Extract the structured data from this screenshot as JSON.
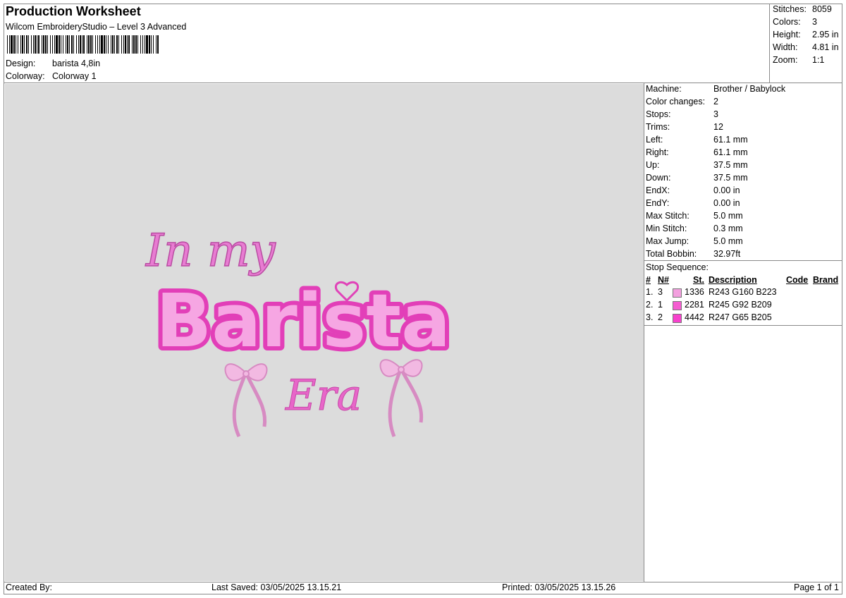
{
  "header": {
    "title": "Production Worksheet",
    "subtitle": "Wilcom EmbroideryStudio – Level 3 Advanced",
    "design_label": "Design:",
    "design_value": "barista 4,8in",
    "colorway_label": "Colorway:",
    "colorway_value": "Colorway 1"
  },
  "summary": [
    {
      "label": "Stitches:",
      "value": "8059"
    },
    {
      "label": "Colors:",
      "value": "3"
    },
    {
      "label": "Height:",
      "value": "2.95 in"
    },
    {
      "label": "Width:",
      "value": "4.81 in"
    },
    {
      "label": "Zoom:",
      "value": "1:1"
    }
  ],
  "design_text": {
    "line1": "In my",
    "line2": "Barista",
    "line3": "Era"
  },
  "machine_info": [
    {
      "label": "Machine:",
      "value": "Brother / Babylock"
    },
    {
      "label": "Color changes:",
      "value": "2"
    },
    {
      "label": "Stops:",
      "value": "3"
    },
    {
      "label": "Trims:",
      "value": "12"
    },
    {
      "label": "Left:",
      "value": "61.1 mm"
    },
    {
      "label": "Right:",
      "value": "61.1 mm"
    },
    {
      "label": "Up:",
      "value": "37.5 mm"
    },
    {
      "label": "Down:",
      "value": "37.5 mm"
    },
    {
      "label": "EndX:",
      "value": "0.00 in"
    },
    {
      "label": "EndY:",
      "value": "0.00 in"
    },
    {
      "label": "Max Stitch:",
      "value": "5.0 mm"
    },
    {
      "label": "Min Stitch:",
      "value": "0.3 mm"
    },
    {
      "label": "Max Jump:",
      "value": "5.0 mm"
    },
    {
      "label": "Total Bobbin:",
      "value": "32.97ft"
    }
  ],
  "stop_sequence": {
    "title": "Stop Sequence:",
    "headers": {
      "num": "#",
      "n": "N#",
      "st": "St.",
      "description": "Description",
      "code": "Code",
      "brand": "Brand"
    },
    "rows": [
      {
        "num": "1.",
        "n": "3",
        "st": "1336",
        "description": "R243 G160 B223",
        "color": "#f3a0df"
      },
      {
        "num": "2.",
        "n": "1",
        "st": "2281",
        "description": "R245 G92 B209",
        "color": "#f55cd1"
      },
      {
        "num": "3.",
        "n": "2",
        "st": "4442",
        "description": "R247 G65 B205",
        "color": "#f741cd"
      }
    ]
  },
  "footer": {
    "created_by": "Created By:",
    "last_saved": "Last Saved: 03/05/2025 13.15.21",
    "printed": "Printed: 03/05/2025 13.15.26",
    "page": "Page 1 of 1"
  }
}
